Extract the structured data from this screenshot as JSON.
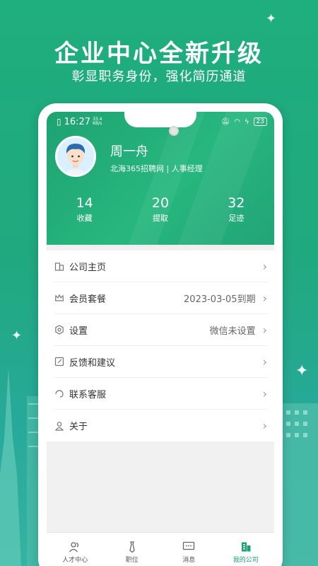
{
  "promo": {
    "title": "企业中心全新升级",
    "subtitle": "彰显职务身份，强化简历通道"
  },
  "status_bar": {
    "time": "16:27",
    "network_speed_value": "33.4",
    "network_speed_unit": "KB/s",
    "battery": "23"
  },
  "profile": {
    "name": "周一舟",
    "title": "北海365招聘网 | 人事经理"
  },
  "stats": [
    {
      "value": "14",
      "label": "收藏"
    },
    {
      "value": "20",
      "label": "提取"
    },
    {
      "value": "32",
      "label": "足迹"
    }
  ],
  "menu": [
    {
      "label": "公司主页",
      "value": "",
      "icon": "building-icon"
    },
    {
      "label": "会员套餐",
      "value": "2023-03-05到期",
      "icon": "crown-icon"
    },
    {
      "label": "设置",
      "value": "微信未设置",
      "icon": "gear-icon"
    },
    {
      "label": "反馈和建议",
      "value": "",
      "icon": "edit-icon"
    },
    {
      "label": "联系客服",
      "value": "",
      "icon": "headset-icon"
    },
    {
      "label": "关于",
      "value": "",
      "icon": "person-icon"
    }
  ],
  "tabs": [
    {
      "label": "人才中心",
      "icon": "people-icon",
      "active": false
    },
    {
      "label": "职位",
      "icon": "tie-icon",
      "active": false
    },
    {
      "label": "消息",
      "icon": "chat-icon",
      "active": false
    },
    {
      "label": "我的公司",
      "icon": "company-icon",
      "active": true
    }
  ],
  "colors": {
    "brand": "#1ea272",
    "background": "#20a97e"
  }
}
